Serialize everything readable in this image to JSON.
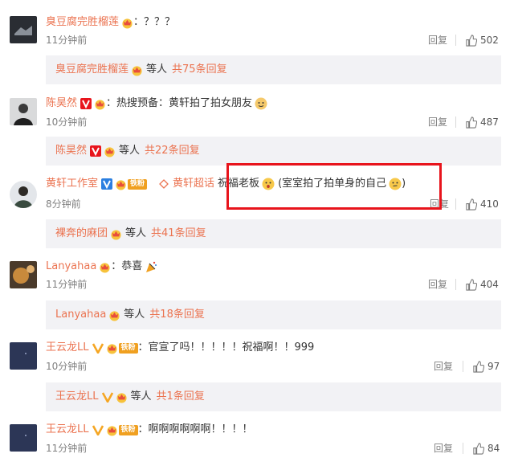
{
  "labels": {
    "reply": "回复",
    "deng_ren": "等人"
  },
  "comments": [
    {
      "name": "臭豆腐完胜榴莲",
      "text": "：？？？",
      "time": "11分钟前",
      "likes": "502",
      "sub": {
        "name": "臭豆腐完胜榴莲",
        "total": "共75条回复"
      }
    },
    {
      "name": "陈昊然",
      "text": "：热搜预备：黄轩拍了拍女朋友",
      "time": "10分钟前",
      "likes": "487",
      "sub": {
        "name": "陈昊然",
        "total": "共22条回复"
      }
    },
    {
      "name": "黄轩工作室",
      "fan": "铁粉",
      "topic": "黄轩超话",
      "text1": "祝福老板",
      "text2": "(室室拍了拍单身的自己",
      "text3": ")",
      "time": "8分钟前",
      "likes": "410",
      "sub": {
        "name": "裸奔的麻团",
        "total": "共41条回复"
      }
    },
    {
      "name": "Lanyahaa",
      "text": "：恭喜",
      "time": "11分钟前",
      "likes": "404",
      "sub": {
        "name": "Lanyahaa",
        "total": "共18条回复"
      }
    },
    {
      "name": "王云龙LL",
      "fan": "铁粉",
      "text": "：官宣了吗！！！！！祝福啊！！999",
      "time": "10分钟前",
      "likes": "97",
      "sub": {
        "name": "王云龙LL",
        "total": "共1条回复"
      }
    },
    {
      "name": "王云龙LL",
      "fan": "铁粉",
      "text": "：啊啊啊啊啊啊！！！！",
      "time": "11分钟前",
      "likes": "84"
    }
  ],
  "colors": {
    "username": "#eb7350",
    "highlight": "#e8141c",
    "subbox_bg": "#f2f2f5"
  },
  "icons": [
    "thumbs-up-icon",
    "crown-badge-icon",
    "verified-v-icon",
    "emoji-icon",
    "topic-diamond-icon"
  ]
}
